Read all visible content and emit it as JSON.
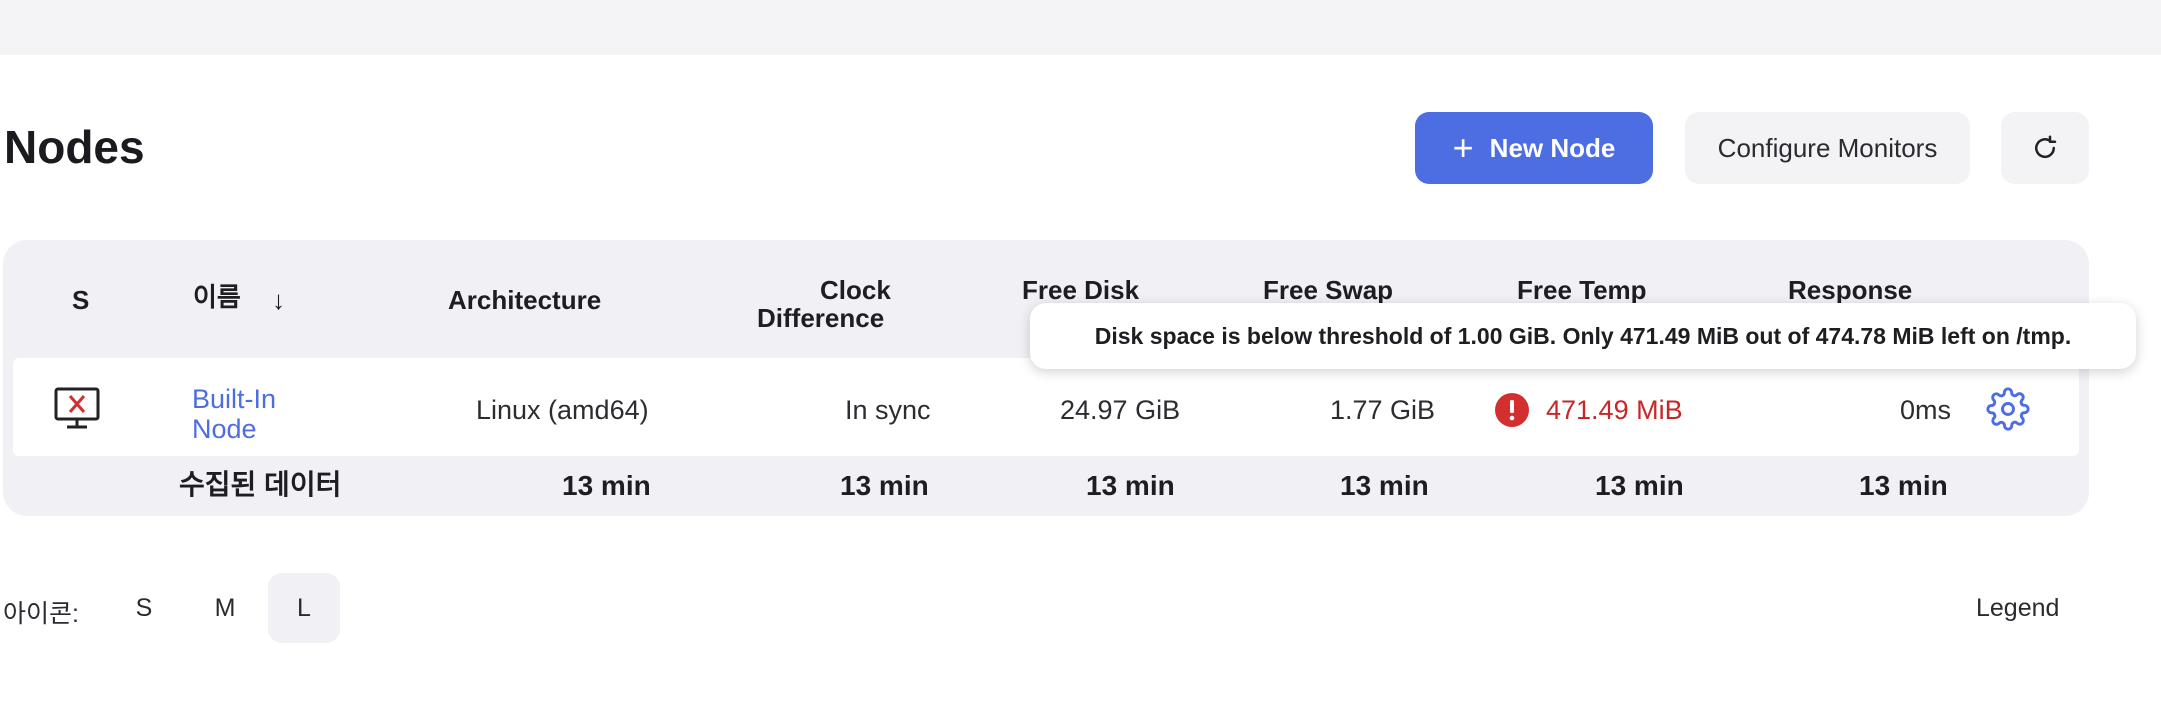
{
  "page": {
    "title": "Nodes"
  },
  "toolbar": {
    "new_node_label": "New Node",
    "configure_monitors_label": "Configure Monitors"
  },
  "table": {
    "headers": {
      "status": "S",
      "name": "이름",
      "sort_indicator": "↓",
      "architecture": "Architecture",
      "clock_line1": "Clock",
      "clock_line2": "Difference",
      "free_disk": "Free Disk",
      "free_swap": "Free Swap",
      "free_temp": "Free Temp",
      "response": "Response"
    },
    "rows": [
      {
        "name_line1": "Built-In",
        "name_line2": "Node",
        "architecture": "Linux (amd64)",
        "clock": "In sync",
        "free_disk": "24.97 GiB",
        "free_swap": "1.77 GiB",
        "free_temp": "471.49 MiB",
        "response": "0ms"
      }
    ],
    "footer": {
      "label": "수집된 데이터",
      "architecture": "13 min",
      "clock": "13 min",
      "free_disk": "13 min",
      "free_swap": "13 min",
      "free_temp": "13 min",
      "response": "13 min"
    }
  },
  "tooltip": {
    "text": "Disk space is below threshold of 1.00 GiB. Only 471.49 MiB out of 474.78 MiB left on /tmp."
  },
  "icon_size": {
    "label": "아이콘:",
    "options": [
      "S",
      "M",
      "L"
    ],
    "selected": "L"
  },
  "legend_label": "Legend",
  "colors": {
    "accent": "#4d6de3",
    "danger": "#c62828",
    "table_bg": "#f1f1f5"
  },
  "icons": [
    "plus-icon",
    "refresh-icon",
    "computer-offline-icon",
    "warning-icon",
    "gear-icon"
  ]
}
